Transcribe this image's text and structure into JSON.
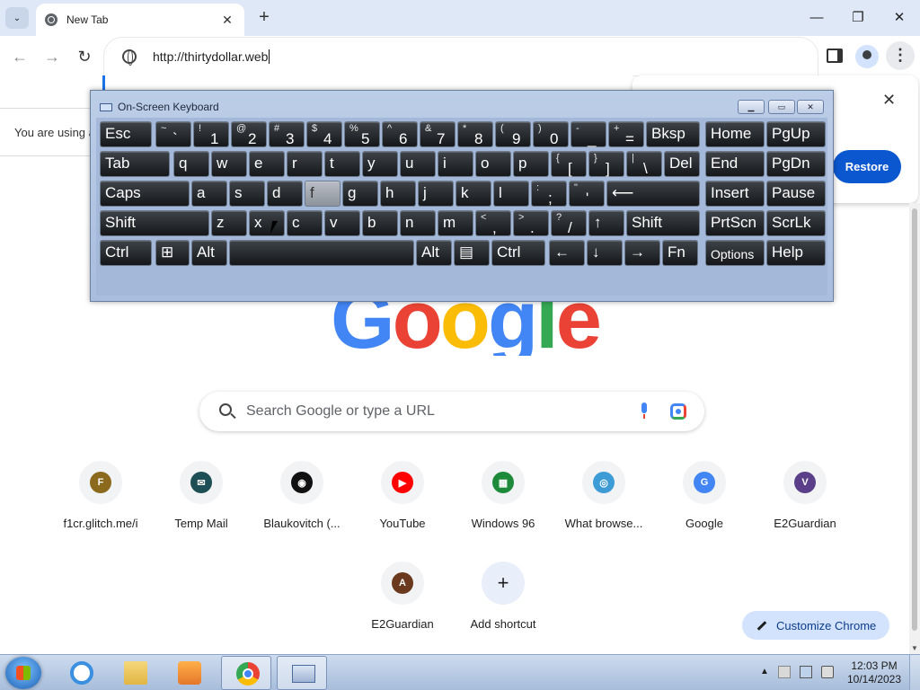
{
  "browser": {
    "tab_title": "New Tab",
    "tab_close": "✕",
    "new_tab": "+",
    "tab_search": "⌄",
    "url": "http://thirtydollar.web",
    "window_min": "—",
    "window_max": "❐",
    "window_close": "✕",
    "back": "←",
    "forward": "→",
    "reload": "↻",
    "menu": "⋮"
  },
  "infobar": {
    "text": "You are using a"
  },
  "restore": {
    "button": "Restore",
    "close": "✕"
  },
  "logo": {
    "letters": [
      "G",
      "o",
      "o",
      "g",
      "l",
      "e"
    ],
    "colors": [
      "#4285f4",
      "#ea4335",
      "#fbbc05",
      "#4285f4",
      "#34a853",
      "#ea4335"
    ]
  },
  "search": {
    "placeholder": "Search Google or type a URL"
  },
  "shortcuts": [
    {
      "label": "f1cr.glitch.me/i",
      "icon_text": "F",
      "icon_color": "#8b6a1e"
    },
    {
      "label": "Temp Mail",
      "icon_text": "✉",
      "icon_color": "#1e4f56"
    },
    {
      "label": "Blaukovitch (...",
      "icon_text": "◉",
      "icon_color": "#111111"
    },
    {
      "label": "YouTube",
      "icon_text": "▶",
      "icon_color": "#ff0000"
    },
    {
      "label": "Windows 96",
      "icon_text": "▦",
      "icon_color": "#1c8a3a"
    },
    {
      "label": "What browse...",
      "icon_text": "◎",
      "icon_color": "#3d9bd6"
    },
    {
      "label": "Google",
      "icon_text": "G",
      "icon_color": "#4285f4"
    },
    {
      "label": "E2Guardian",
      "icon_text": "V",
      "icon_color": "#5b3f8a"
    },
    {
      "label": "E2Guardian",
      "icon_text": "A",
      "icon_color": "#6b3a1e"
    },
    {
      "label": "Add shortcut",
      "icon_text": "+",
      "icon_color": "#1f1f1f"
    }
  ],
  "customize": {
    "label": "Customize Chrome"
  },
  "osk": {
    "title": "On-Screen Keyboard",
    "controls": [
      "▁",
      "▭",
      "✕"
    ],
    "rows": [
      [
        {
          "m": "Esc"
        },
        {
          "s": "~",
          "b": "`"
        },
        {
          "s": "!",
          "b": "1"
        },
        {
          "s": "@",
          "b": "2"
        },
        {
          "s": "#",
          "b": "3"
        },
        {
          "s": "$",
          "b": "4"
        },
        {
          "s": "%",
          "b": "5"
        },
        {
          "s": "^",
          "b": "6"
        },
        {
          "s": "&",
          "b": "7"
        },
        {
          "s": "*",
          "b": "8"
        },
        {
          "s": "(",
          "b": "9"
        },
        {
          "s": ")",
          "b": "0"
        },
        {
          "s": "-",
          "b": "_"
        },
        {
          "s": "+",
          "b": "="
        },
        {
          "m": "Bksp"
        },
        {
          "m": "Home"
        },
        {
          "m": "PgUp"
        }
      ],
      [
        {
          "m": "Tab"
        },
        {
          "m": "q"
        },
        {
          "m": "w"
        },
        {
          "m": "e"
        },
        {
          "m": "r"
        },
        {
          "m": "t"
        },
        {
          "m": "y"
        },
        {
          "m": "u"
        },
        {
          "m": "i"
        },
        {
          "m": "o"
        },
        {
          "m": "p"
        },
        {
          "s": "{",
          "b": "["
        },
        {
          "s": "}",
          "b": "]"
        },
        {
          "s": "|",
          "b": "\\"
        },
        {
          "m": "Del"
        },
        {
          "m": "End"
        },
        {
          "m": "PgDn"
        }
      ],
      [
        {
          "m": "Caps"
        },
        {
          "m": "a"
        },
        {
          "m": "s"
        },
        {
          "m": "d"
        },
        {
          "m": "f"
        },
        {
          "m": "g"
        },
        {
          "m": "h"
        },
        {
          "m": "j"
        },
        {
          "m": "k"
        },
        {
          "m": "l"
        },
        {
          "s": ":",
          "b": ";"
        },
        {
          "s": "\"",
          "b": "'"
        },
        {
          "m": "⟵"
        },
        {
          "m": "Insert"
        },
        {
          "m": "Pause"
        }
      ],
      [
        {
          "m": "Shift"
        },
        {
          "m": "z"
        },
        {
          "m": "x"
        },
        {
          "m": "c"
        },
        {
          "m": "v"
        },
        {
          "m": "b"
        },
        {
          "m": "n"
        },
        {
          "m": "m"
        },
        {
          "s": "<",
          "b": ","
        },
        {
          "s": ">",
          "b": "."
        },
        {
          "s": "?",
          "b": "/"
        },
        {
          "m": "↑"
        },
        {
          "m": "Shift"
        },
        {
          "m": "PrtScn"
        },
        {
          "m": "ScrLk"
        }
      ],
      [
        {
          "m": "Ctrl"
        },
        {
          "m": "⊞"
        },
        {
          "m": "Alt"
        },
        {
          "m": ""
        },
        {
          "m": "Alt"
        },
        {
          "m": "▤"
        },
        {
          "m": "Ctrl"
        },
        {
          "m": "←"
        },
        {
          "m": "↓"
        },
        {
          "m": "→"
        },
        {
          "m": "Fn"
        },
        {
          "m": "Options"
        },
        {
          "m": "Help"
        }
      ]
    ]
  },
  "taskbar": {
    "apps": [
      "internet-explorer",
      "file-explorer",
      "media-player",
      "chrome",
      "on-screen-keyboard"
    ],
    "time": "12:03 PM",
    "date": "10/14/2023",
    "tray_up": "▲"
  }
}
